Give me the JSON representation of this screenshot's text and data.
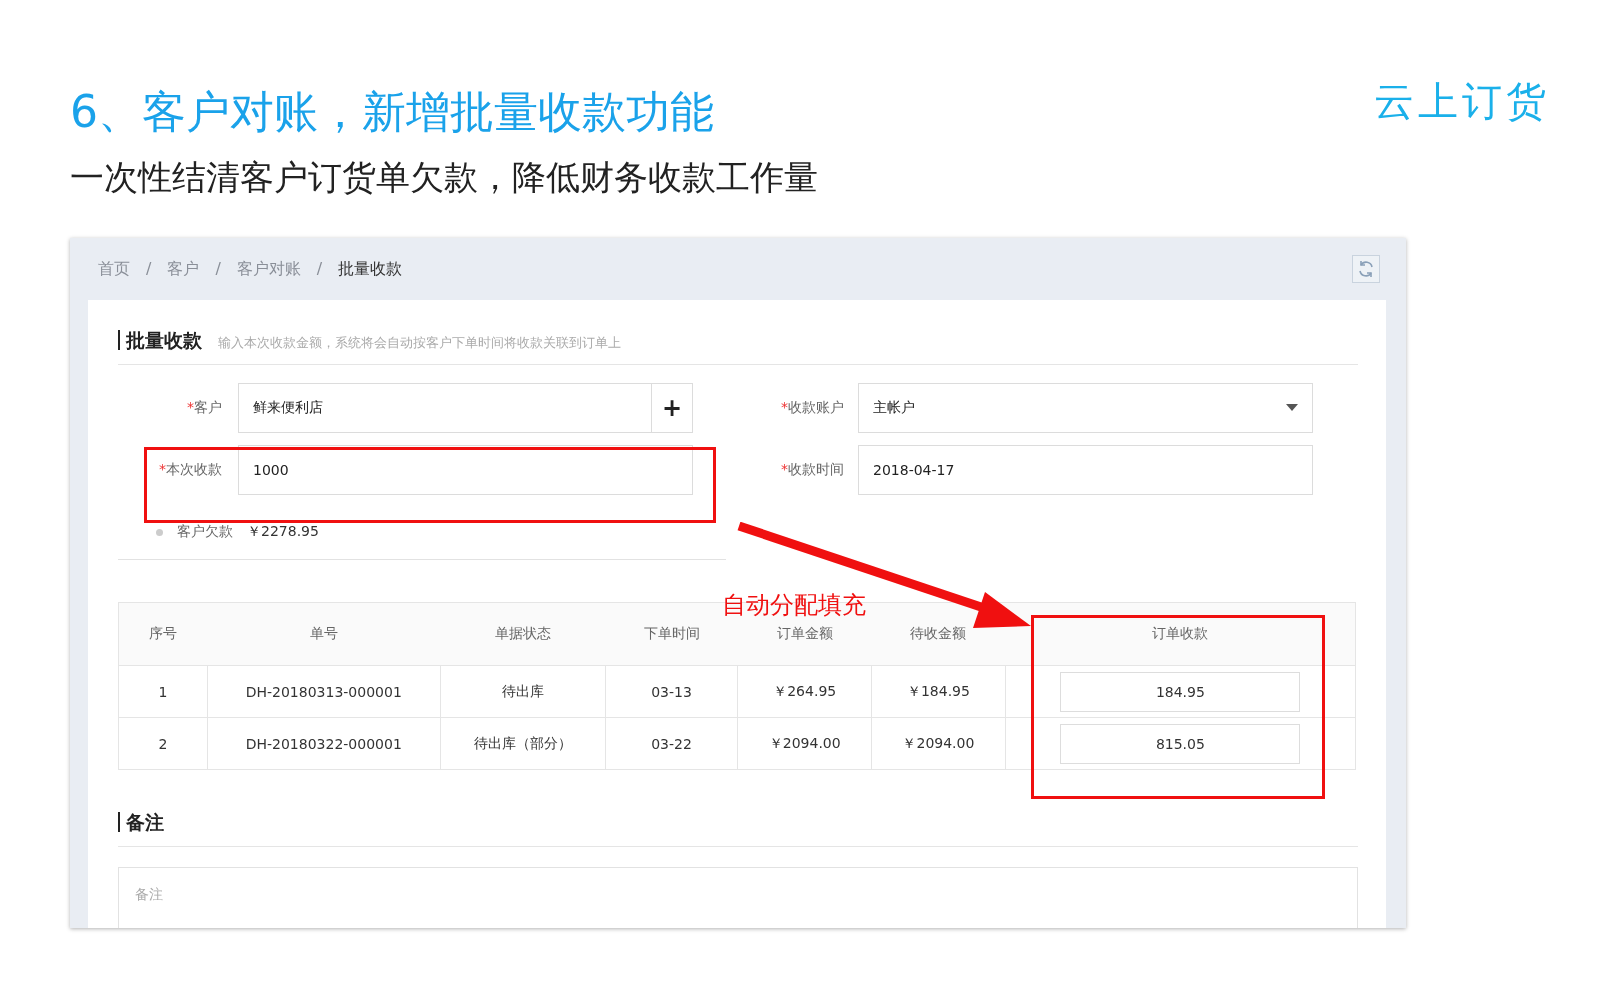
{
  "slide": {
    "title": "6、客户对账，新增批量收款功能",
    "subtitle": "一次性结清客户订货单欠款，降低财务收款工作量",
    "logo": "云上订货"
  },
  "breadcrumb": [
    {
      "kind": "link",
      "label": "首页"
    },
    {
      "kind": "separator",
      "label": "/"
    },
    {
      "kind": "link",
      "label": "客户"
    },
    {
      "kind": "separator",
      "label": "/"
    },
    {
      "kind": "link",
      "label": "客户对账"
    },
    {
      "kind": "separator",
      "label": "/"
    },
    {
      "kind": "current",
      "label": "批量收款"
    }
  ],
  "section": {
    "title": "批量收款",
    "hint": "输入本次收款金额，系统将会自动按客户下单时间将收款关联到订单上"
  },
  "form": {
    "customer": {
      "mark": "*",
      "label": "客户",
      "value": "鲜来便利店",
      "add": "+"
    },
    "account": {
      "mark": "*",
      "label": "收款账户",
      "value": "主帐户"
    },
    "amount": {
      "mark": "*",
      "label": "本次收款",
      "value": "1000"
    },
    "date": {
      "mark": "*",
      "label": "收款时间",
      "value": "2018-04-17"
    },
    "debt": {
      "label": "客户欠款",
      "value": "￥2278.95"
    }
  },
  "table": {
    "columns": [
      "序号",
      "单号",
      "单据状态",
      "下单时间",
      "订单金额",
      "待收金额",
      "订单收款"
    ],
    "rows": [
      {
        "cells": [
          "1",
          "DH-20180313-000001",
          "待出库",
          "03-13",
          "￥264.95",
          "￥184.95"
        ],
        "payment": "184.95"
      },
      {
        "cells": [
          "2",
          "DH-20180322-000001",
          "待出库（部分）",
          "03-22",
          "￥2094.00",
          "￥2094.00"
        ],
        "payment": "815.05"
      }
    ]
  },
  "remarks": {
    "title": "备注",
    "placeholder": "备注"
  },
  "annotation": {
    "label": "自动分配填充"
  }
}
